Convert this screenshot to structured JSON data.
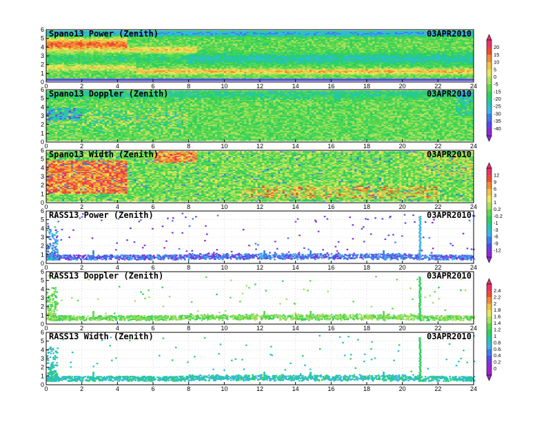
{
  "figure": {
    "date": "03APR2010",
    "x_ticks": [
      "0",
      "2",
      "4",
      "6",
      "8",
      "10",
      "12",
      "14",
      "16",
      "18",
      "20",
      "22",
      "24"
    ],
    "y_ticks": [
      "0",
      "1",
      "2",
      "3",
      "4",
      "5",
      "6"
    ]
  },
  "chart_data": [
    {
      "type": "heatmap",
      "title": "Spano13 Power (Zenith)",
      "date": "03APR2010",
      "xlim": [
        0,
        24
      ],
      "ylim": [
        0,
        6
      ],
      "x_ticks": [
        0,
        2,
        4,
        6,
        8,
        10,
        12,
        14,
        16,
        18,
        20,
        22,
        24
      ],
      "y_ticks": [
        0,
        1,
        2,
        3,
        4,
        5,
        6
      ],
      "colorbar": "scale_a",
      "features": [
        {
          "x": [
            0,
            4.6
          ],
          "y": [
            3.4,
            5.2
          ],
          "level": 5
        },
        {
          "x": [
            4.6,
            8.5
          ],
          "y": [
            3.2,
            4.3
          ],
          "level": 0
        },
        {
          "x": [
            5,
            24
          ],
          "y": [
            0.9,
            1.6
          ],
          "level": 5
        },
        {
          "x": [
            0,
            24
          ],
          "y": [
            0.2,
            0.45
          ],
          "level": -30
        }
      ]
    },
    {
      "type": "heatmap",
      "title": "Spano13 Doppler (Zenith)",
      "date": "03APR2010",
      "xlim": [
        0,
        24
      ],
      "ylim": [
        0,
        6
      ],
      "x_ticks": [
        0,
        2,
        4,
        6,
        8,
        10,
        12,
        14,
        16,
        18,
        20,
        22,
        24
      ],
      "y_ticks": [
        0,
        1,
        2,
        3,
        4,
        5,
        6
      ],
      "colorbar": "scale_a",
      "features": [
        {
          "x": [
            0,
            8
          ],
          "y": [
            1,
            4.5
          ],
          "level": 0
        },
        {
          "x": [
            0,
            2
          ],
          "y": [
            2.5,
            4
          ],
          "level": -30
        }
      ]
    },
    {
      "type": "heatmap",
      "title": "Spano13 Width (Zenith)",
      "date": "03APR2010",
      "xlim": [
        0,
        24
      ],
      "ylim": [
        0,
        6
      ],
      "x_ticks": [
        0,
        2,
        4,
        6,
        8,
        10,
        12,
        14,
        16,
        18,
        20,
        22,
        24
      ],
      "y_ticks": [
        0,
        1,
        2,
        3,
        4,
        5,
        6
      ],
      "colorbar": "scale_b",
      "features": [
        {
          "x": [
            0,
            4.5
          ],
          "y": [
            1,
            4.8
          ],
          "level": 6
        },
        {
          "x": [
            6,
            8.5
          ],
          "y": [
            4.8,
            6
          ],
          "level": 6
        },
        {
          "x": [
            11,
            22
          ],
          "y": [
            0.5,
            2
          ],
          "level": 6
        }
      ]
    },
    {
      "type": "scatter",
      "title": "RASS13 Power (Zenith)",
      "date": "03APR2010",
      "xlim": [
        0,
        24
      ],
      "ylim": [
        0,
        6
      ],
      "x_ticks": [
        0,
        2,
        4,
        6,
        8,
        10,
        12,
        14,
        16,
        18,
        20,
        22,
        24
      ],
      "y_ticks": [
        0,
        1,
        2,
        3,
        4,
        5,
        6
      ],
      "colorbar": "scale_b",
      "features": [
        {
          "x": [
            0,
            24
          ],
          "y": [
            0.5,
            1.0
          ],
          "level": -9
        },
        {
          "x": [
            20.9,
            21.0
          ],
          "y": [
            0.5,
            5.6
          ],
          "level": -3
        }
      ]
    },
    {
      "type": "scatter",
      "title": "RASS13 Doppler (Zenith)",
      "date": "03APR2010",
      "xlim": [
        0,
        24
      ],
      "ylim": [
        0,
        6
      ],
      "x_ticks": [
        0,
        2,
        4,
        6,
        8,
        10,
        12,
        14,
        16,
        18,
        20,
        22,
        24
      ],
      "y_ticks": [
        0,
        1,
        2,
        3,
        4,
        5,
        6
      ],
      "colorbar": "scale_c",
      "features": [
        {
          "x": [
            0,
            24
          ],
          "y": [
            0.5,
            1.0
          ],
          "level": 1.2
        },
        {
          "x": [
            20.9,
            21.0
          ],
          "y": [
            0.5,
            5.6
          ],
          "level": 1.0
        }
      ]
    },
    {
      "type": "scatter",
      "title": "RASS13 Width (Zenith)",
      "date": "03APR2010",
      "xlim": [
        0,
        24
      ],
      "ylim": [
        0,
        6
      ],
      "x_ticks": [
        0,
        2,
        4,
        6,
        8,
        10,
        12,
        14,
        16,
        18,
        20,
        22,
        24
      ],
      "y_ticks": [
        0,
        1,
        2,
        3,
        4,
        5,
        6
      ],
      "colorbar": "scale_c",
      "features": [
        {
          "x": [
            0,
            24
          ],
          "y": [
            0.5,
            1.0
          ],
          "level": 0.8
        },
        {
          "x": [
            20.9,
            21.0
          ],
          "y": [
            0.5,
            5.6
          ],
          "level": 1.0
        }
      ]
    }
  ],
  "colorbars": {
    "scale_a": {
      "labels": [
        "20",
        "15",
        "10",
        "5",
        "0",
        "-5",
        "-15",
        "-20",
        "-25",
        "-30",
        "-35",
        "-40"
      ],
      "colors": [
        "#e8326a",
        "#f04a32",
        "#f08a32",
        "#f2c046",
        "#e8e65a",
        "#a8e05a",
        "#5cd84e",
        "#2ed060",
        "#22c8a8",
        "#38b6e6",
        "#3a7ef0",
        "#5a48e8",
        "#8e2ad8"
      ]
    },
    "scale_b": {
      "labels": [
        "12",
        "9",
        "6",
        "3",
        "1",
        "0.2",
        "-0.2",
        "-1",
        "-3",
        "-6",
        "-9",
        "-12"
      ],
      "colors": [
        "#e8326a",
        "#f04a32",
        "#f08a32",
        "#f2c046",
        "#e8e65a",
        "#a8e05a",
        "#5cd84e",
        "#2ed060",
        "#22c8a8",
        "#38b6e6",
        "#3a7ef0",
        "#5a48e8",
        "#8e2ad8"
      ]
    },
    "scale_c": {
      "labels": [
        "2.4",
        "2.2",
        "2",
        "1.8",
        "1.6",
        "1.4",
        "1.2",
        "1",
        "0.8",
        "0.6",
        "0.4",
        "0.2",
        "0"
      ],
      "colors": [
        "#e8326a",
        "#f04a32",
        "#f08a32",
        "#f2c046",
        "#e8e65a",
        "#a8e05a",
        "#5cd84e",
        "#2ed060",
        "#22c8a8",
        "#38b6e6",
        "#3a7ef0",
        "#5a48e8",
        "#8e2ad8",
        "#a020d0"
      ]
    }
  }
}
